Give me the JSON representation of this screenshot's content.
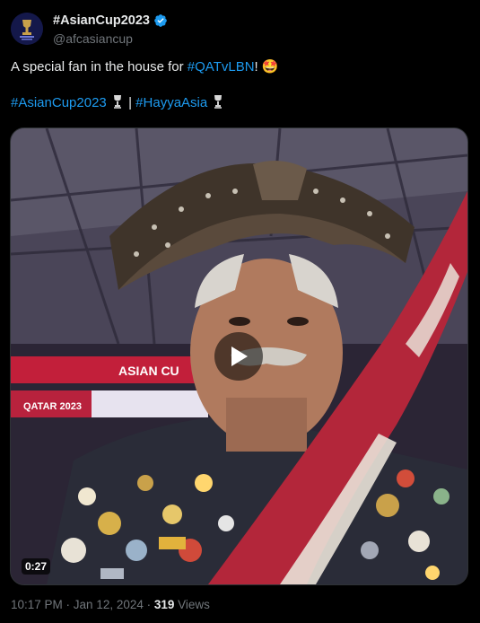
{
  "author": {
    "display_name": "#AsianCup2023",
    "handle": "@afcasiancup",
    "verified": true,
    "avatar_icon": "afc-asian-cup-logo-icon"
  },
  "tweet": {
    "line1_text": "A special fan in the house for ",
    "line1_hashtag": "#QATvLBN",
    "line1_suffix": "!",
    "line1_emoji": "🤩",
    "line2_hashtag1": "#AsianCup2023",
    "line2_separator": " | ",
    "line2_hashtag2": "#HayyaAsia",
    "trophy_icon": "trophy-icon"
  },
  "media": {
    "type": "video",
    "duration": "0:27",
    "play_icon": "play-icon",
    "banner_text_1": "ASIAN CU",
    "banner_text_2": "QATAR 2023"
  },
  "meta": {
    "time": "10:17 PM",
    "separator": " · ",
    "date": "Jan 12, 2024",
    "views_count": "319",
    "views_label": " Views"
  },
  "colors": {
    "background": "#000000",
    "text": "#e7e9ea",
    "secondary": "#71767b",
    "link": "#1d9bf0",
    "verified": "#1d9bf0"
  }
}
